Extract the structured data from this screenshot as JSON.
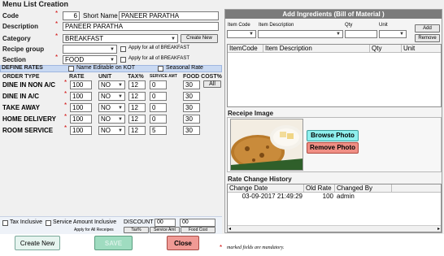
{
  "window": {
    "title": "Menu List Creation"
  },
  "form": {
    "code_label": "Code",
    "code_value": "6",
    "short_name_label": "Short Name",
    "short_name_value": "PANEER PARATHA",
    "description_label": "Description",
    "description_value": "PANEER PARATHA",
    "category_label": "Category",
    "category_value": "BREAKFAST",
    "create_new_label": "Create New",
    "recipe_group_label": "Recipe group",
    "recipe_group_value": "",
    "apply_all_breakfast_1": "Apply for all of BREAKFAST",
    "section_label": "Section",
    "section_value": "FOOD",
    "apply_all_breakfast_2": "Apply for all of BREAKFAST"
  },
  "rates": {
    "header_label": "DEFINE RATES",
    "name_editable_label": "Name Editable on KOT",
    "seasonal_rate_label": "Seasonal Rate",
    "columns": [
      "ORDER TYPE",
      "RATE",
      "UNIT",
      "TAX%",
      "SERVICE AMT",
      "FOOD COST%"
    ],
    "all_label": "All",
    "rows": [
      {
        "order_type": "DINE IN NON A/C",
        "rate": "100",
        "unit": "NO",
        "tax": "12",
        "service": "0",
        "food_cost": "30"
      },
      {
        "order_type": "DINE IN A/C",
        "rate": "100",
        "unit": "NO",
        "tax": "12",
        "service": "0",
        "food_cost": "30"
      },
      {
        "order_type": "TAKE AWAY",
        "rate": "100",
        "unit": "NO",
        "tax": "12",
        "service": "0",
        "food_cost": "30"
      },
      {
        "order_type": "HOME DELIVERY",
        "rate": "100",
        "unit": "NO",
        "tax": "12",
        "service": "0",
        "food_cost": "30"
      },
      {
        "order_type": "ROOM SERVICE",
        "rate": "100",
        "unit": "NO",
        "tax": "12",
        "service": "5",
        "food_cost": "30"
      }
    ]
  },
  "bottom_options": {
    "tax_inclusive_label": "Tax Inclusive",
    "service_inclusive_label": "Service Amount Inclusive",
    "discount_label": "DISCOUNT %",
    "discount_value_1": "00",
    "discount_value_2": "00",
    "apply_all_recipes_label": "Apply for All Receipes",
    "tax_btn": "Tax%",
    "service_btn": "Service Amt",
    "food_cost_btn": "Food Cost"
  },
  "ingredients": {
    "title": "Add Ingredients (Bill of Material )",
    "item_code_label": "Item Code",
    "item_desc_label": "Item Description",
    "qty_label": "Qty",
    "unit_label": "Unit",
    "add_label": "Add",
    "remove_label": "Remove",
    "columns": [
      "ItemCode",
      "Item Description",
      "Qty",
      "Unit"
    ]
  },
  "image": {
    "title": "Receipe Image",
    "browse_label": "Browse Photo",
    "remove_label": "Remove Photo"
  },
  "history": {
    "title": "Rate Change History",
    "columns": [
      "Change Date",
      "Old Rate",
      "Changed By"
    ],
    "rows": [
      {
        "date": "03-09-2017 21:49:29",
        "old_rate": "100",
        "changed_by": "admin"
      }
    ]
  },
  "footer": {
    "create_new_label": "Create New",
    "save_label": "SAVE",
    "close_label": "Close",
    "mandatory_note": "marked fields are mandatory.",
    "mandatory_star": "*"
  },
  "colors": {
    "accent_blue": "#c9d9f2",
    "browse_btn": "#8ff0ee",
    "remove_btn": "#f08f85",
    "save_btn": "#9fdcc0",
    "close_btn": "#f09a95",
    "create_btn": "#e6f4ef"
  },
  "icons": [
    "dropdown-arrow-icon",
    "checkbox-icon",
    "paratha-photo",
    "scroll-left-icon",
    "scroll-right-icon"
  ]
}
